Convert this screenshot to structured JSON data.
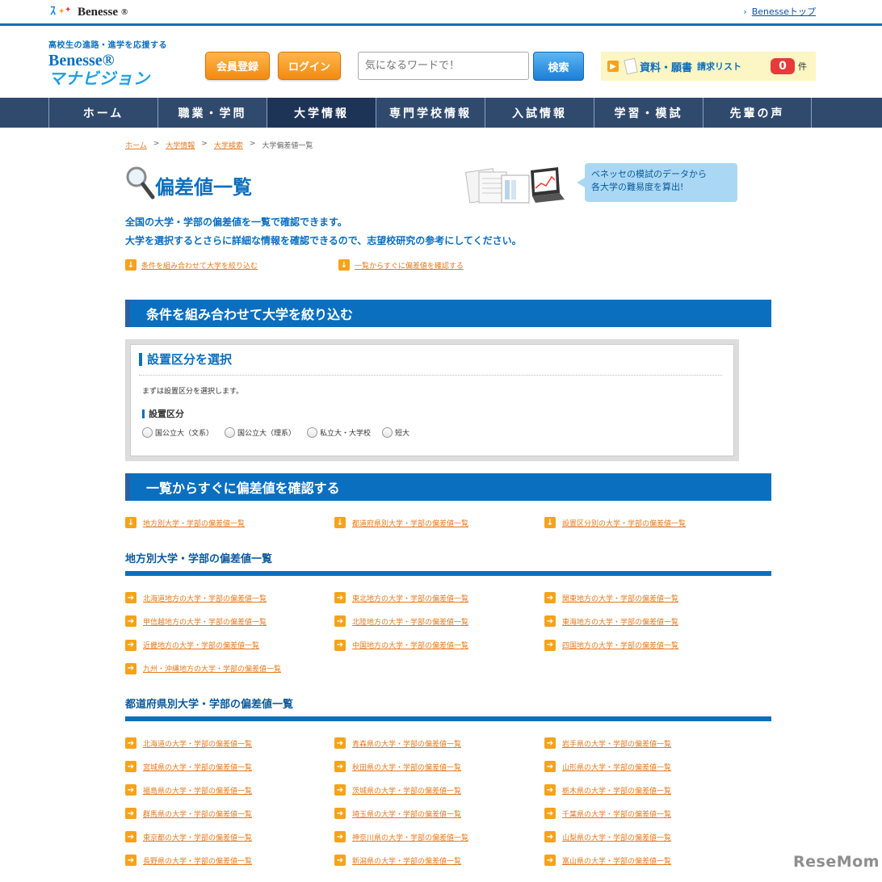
{
  "topbar": {
    "logo": "Benesse",
    "logo_mark": "®",
    "top_link": "Benesseトップ"
  },
  "header": {
    "tagline": "高校生の進路・進学を応援する",
    "brand1": "Benesse®",
    "brand2": "マナビジョン",
    "register_label": "会員登録",
    "login_label": "ログイン",
    "search_placeholder": "気になるワードで！",
    "search_button": "検索",
    "request_label": "資料・願書",
    "request_sub": "請求リスト",
    "request_count": "0",
    "request_unit": "件"
  },
  "nav": [
    "ホーム",
    "職業・学問",
    "大学情報",
    "専門学校情報",
    "入試情報",
    "学習・模試",
    "先輩の声"
  ],
  "breadcrumb": {
    "items": [
      "ホーム",
      "大学情報",
      "大学検索"
    ],
    "current": "大学偏差値一覧",
    "sep": ">"
  },
  "title": "偏差値一覧",
  "bubble": [
    "ベネッセの模試のデータから",
    "各大学の難易度を算出!"
  ],
  "intro": [
    "全国の大学・学部の偏差値を一覧で確認できます。",
    "大学を選択するとさらに詳細な情報を確認できるので、志望校研究の参考にしてください。"
  ],
  "jumps": [
    "条件を組み合わせて大学を絞り込む",
    "一覧からすぐに偏差値を確認する"
  ],
  "section1": "条件を組み合わせて大学を絞り込む",
  "filter": {
    "title": "設置区分を選択",
    "desc": "まずは設置区分を選択します。",
    "label": "設置区分",
    "options": [
      "国公立大（文系）",
      "国公立大（理系）",
      "私立大・大学校",
      "短大"
    ]
  },
  "section2": "一覧からすぐに偏差値を確認する",
  "quick_links": [
    "地方別大学・学部の偏差値一覧",
    "都道府県別大学・学部の偏差値一覧",
    "設置区分別の大学・学部の偏差値一覧"
  ],
  "region_head": "地方別大学・学部の偏差値一覧",
  "regions": [
    "北海道地方の大学・学部の偏差値一覧",
    "東北地方の大学・学部の偏差値一覧",
    "関東地方の大学・学部の偏差値一覧",
    "甲信越地方の大学・学部の偏差値一覧",
    "北陸地方の大学・学部の偏差値一覧",
    "東海地方の大学・学部の偏差値一覧",
    "近畿地方の大学・学部の偏差値一覧",
    "中国地方の大学・学部の偏差値一覧",
    "四国地方の大学・学部の偏差値一覧",
    "九州・沖縄地方の大学・学部の偏差値一覧"
  ],
  "pref_head": "都道府県別大学・学部の偏差値一覧",
  "prefs": [
    "北海道の大学・学部の偏差値一覧",
    "青森県の大学・学部の偏差値一覧",
    "岩手県の大学・学部の偏差値一覧",
    "宮城県の大学・学部の偏差値一覧",
    "秋田県の大学・学部の偏差値一覧",
    "山形県の大学・学部の偏差値一覧",
    "福島県の大学・学部の偏差値一覧",
    "茨城県の大学・学部の偏差値一覧",
    "栃木県の大学・学部の偏差値一覧",
    "群馬県の大学・学部の偏差値一覧",
    "埼玉県の大学・学部の偏差値一覧",
    "千葉県の大学・学部の偏差値一覧",
    "東京都の大学・学部の偏差値一覧",
    "神奈川県の大学・学部の偏差値一覧",
    "山梨県の大学・学部の偏差値一覧",
    "長野県の大学・学部の偏差値一覧",
    "新潟県の大学・学部の偏差値一覧",
    "富山県の大学・学部の偏差値一覧"
  ],
  "watermark": "ReseMom"
}
